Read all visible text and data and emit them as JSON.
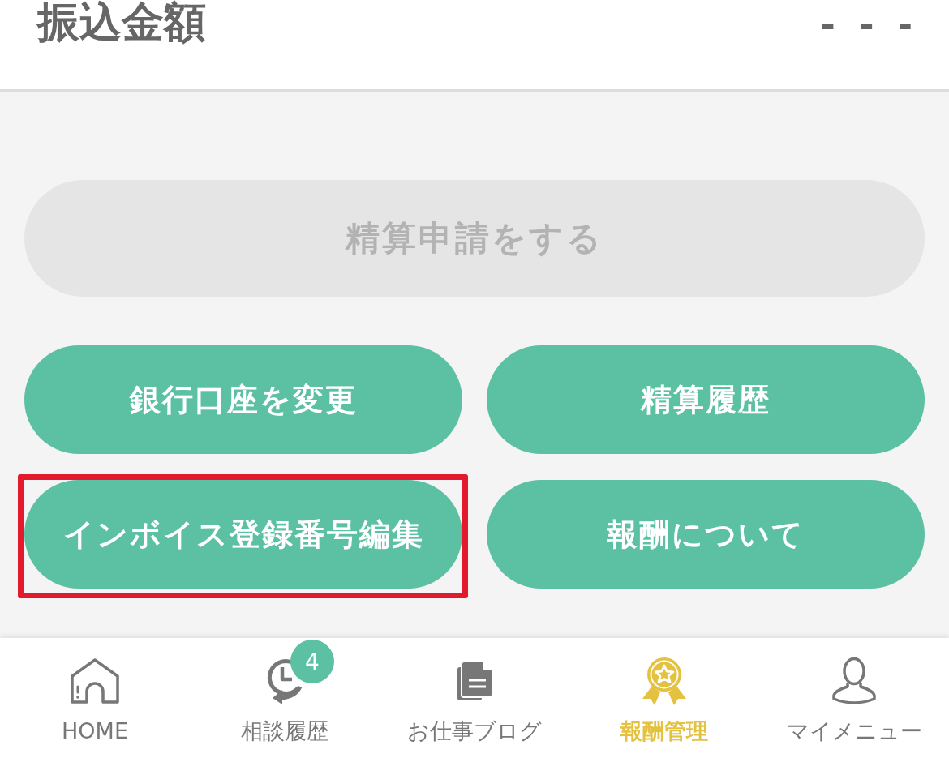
{
  "header": {
    "title": "振込金額",
    "amount": "- - -"
  },
  "settlement_button": {
    "label": "精算申請をする",
    "disabled": true
  },
  "actions": [
    {
      "label": "銀行口座を変更",
      "highlighted": false
    },
    {
      "label": "精算履歴",
      "highlighted": false
    },
    {
      "label": "インボイス登録番号編集",
      "highlighted": true
    },
    {
      "label": "報酬について",
      "highlighted": false
    }
  ],
  "tab_bar": [
    {
      "kind": "home",
      "label": "HOME",
      "selected": false
    },
    {
      "kind": "history",
      "label": "相談履歴",
      "selected": false,
      "badge": "4"
    },
    {
      "kind": "blog",
      "label": "お仕事ブログ",
      "selected": false
    },
    {
      "kind": "reward",
      "label": "報酬管理",
      "selected": true
    },
    {
      "kind": "account",
      "label": "マイメニュー",
      "selected": false
    }
  ]
}
